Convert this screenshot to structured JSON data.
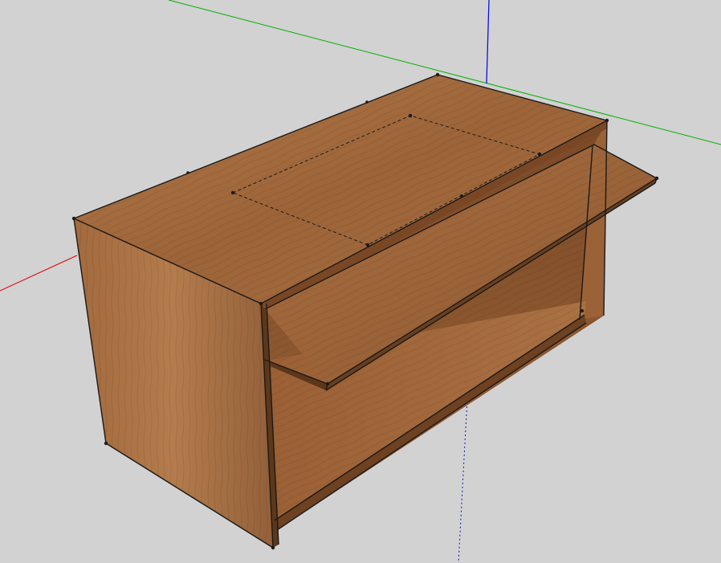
{
  "viewport": {
    "background": "#d2d2d2"
  },
  "axes": {
    "red": "#e00000",
    "green": "#00b000",
    "blue": "#1010e0"
  },
  "model": {
    "name": "cabinet",
    "parts": [
      "left-side-panel",
      "top-panel",
      "back-panel",
      "bottom-shelf",
      "pull-out-shelf",
      "dashed-cutout-outline"
    ],
    "material": {
      "wood_light": "#a86b3d",
      "wood_mid": "#8f5a30",
      "wood_dark": "#6e4121",
      "edge": "#1a1a1a"
    }
  }
}
